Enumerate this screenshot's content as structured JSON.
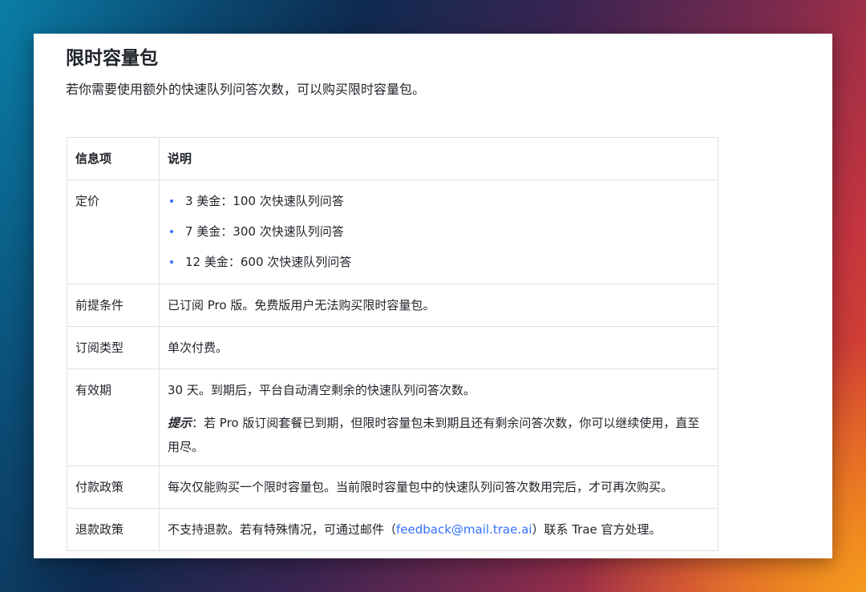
{
  "title": "限时容量包",
  "intro": "若你需要使用额外的快速队列问答次数，可以购买限时容量包。",
  "table": {
    "headers": [
      "信息项",
      "说明"
    ],
    "pricing": {
      "label": "定价",
      "items": [
        "3 美金：100 次快速队列问答",
        "7 美金：300 次快速队列问答",
        "12 美金：600 次快速队列问答"
      ]
    },
    "prerequisite": {
      "label": "前提条件",
      "value": "已订阅 Pro 版。免费版用户无法购买限时容量包。"
    },
    "subscription_type": {
      "label": "订阅类型",
      "value": "单次付费。"
    },
    "validity": {
      "label": "有效期",
      "value": "30 天。到期后，平台自动清空剩余的快速队列问答次数。",
      "tip_label": "提示",
      "tip_text": "：若 Pro 版订阅套餐已到期，但限时容量包未到期且还有剩余问答次数，你可以继续使用，直至用尽。"
    },
    "payment_policy": {
      "label": "付款政策",
      "value": "每次仅能购买一个限时容量包。当前限时容量包中的快速队列问答次数用完后，才可再次购买。"
    },
    "refund_policy": {
      "label": "退款政策",
      "text_before": "不支持退款。若有特殊情况，可通过邮件（",
      "email": "feedback@mail.trae.ai",
      "text_after": "）联系 Trae 官方处理。"
    }
  },
  "colors": {
    "link": "#3370ff",
    "bullet": "#3370ff",
    "text": "#1f2329",
    "border": "#dee0e3"
  }
}
